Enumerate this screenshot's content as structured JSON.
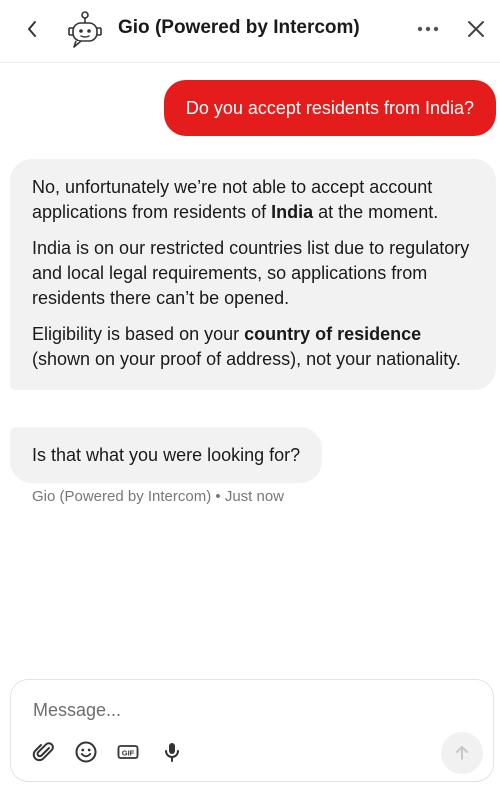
{
  "header": {
    "title": "Gio (Powered by Intercom)",
    "back_icon": "chevron-left-icon",
    "avatar_icon": "robot-icon",
    "more_icon": "more-horizontal-icon",
    "close_icon": "close-icon"
  },
  "messages": {
    "user": "Do you accept residents from India?",
    "bot": {
      "p1_before": "No, unfortunately we’re not able to accept account applications from residents of ",
      "p1_bold": "India",
      "p1_after": " at the moment.",
      "p2": "India is on our restricted countries list due to regulatory and local legal requirements, so applications from residents there can’t be opened.",
      "p3_before": "Eligibility is based on your ",
      "p3_bold": "country of residence",
      "p3_after": " (shown on your proof of address), not your nationality."
    },
    "bot_followup": "Is that what you were looking for?",
    "meta": "Gio (Powered by Intercom) • Just now"
  },
  "composer": {
    "placeholder": "Message...",
    "tools": [
      "paperclip-icon",
      "smiley-icon",
      "gif-icon",
      "microphone-icon"
    ],
    "gif_label": "GIF",
    "send_icon": "arrow-up-icon"
  },
  "colors": {
    "user_bubble": "#e41c1c",
    "bot_bubble": "#f2f2f2",
    "meta_text": "#777777"
  }
}
